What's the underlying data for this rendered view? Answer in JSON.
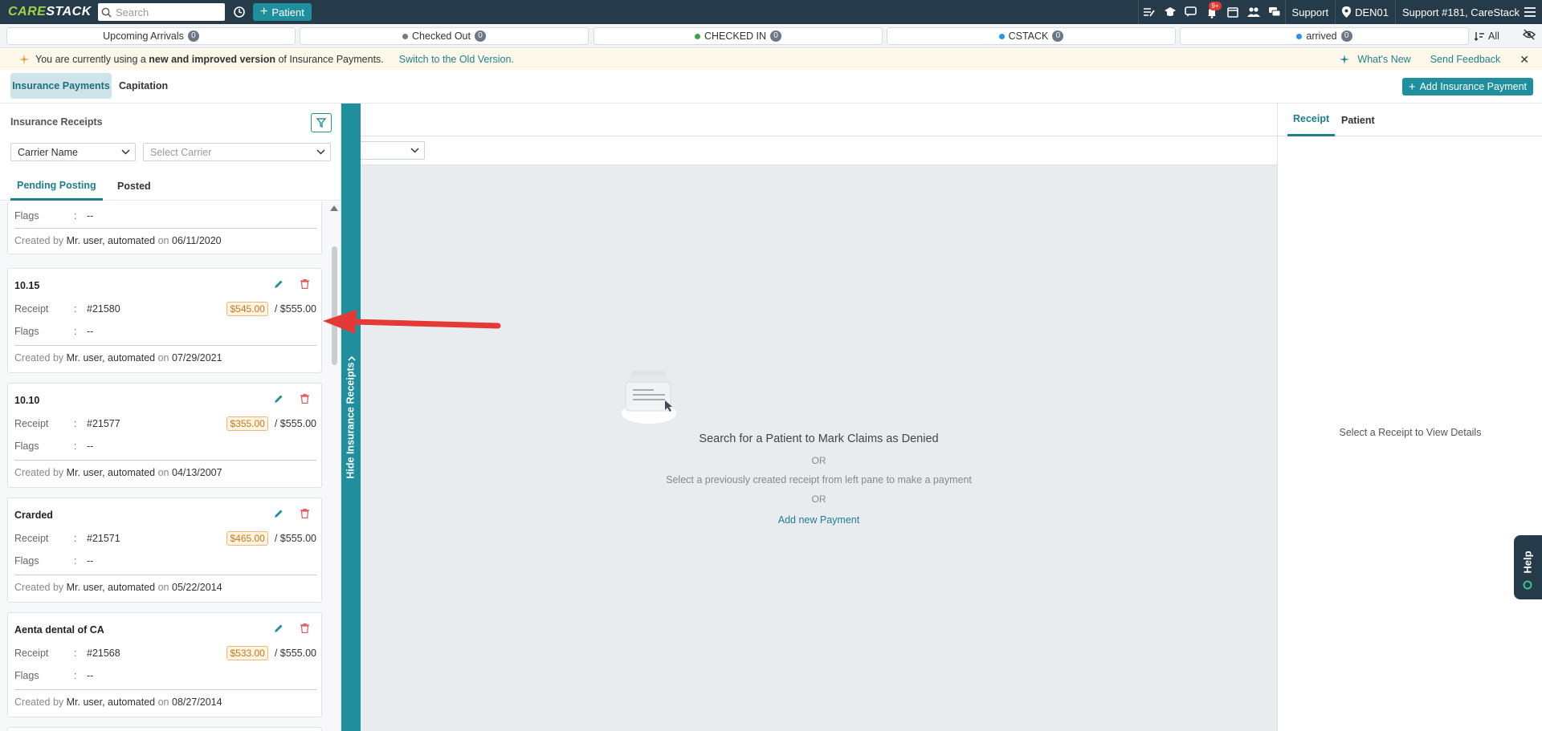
{
  "app": {
    "logo": "CARESTACK",
    "search_placeholder": "Search",
    "patient_button": "Patient",
    "badge_count": "9+",
    "support_label": "Support",
    "location": "DEN01",
    "user_label": "Support #181, CareStack"
  },
  "status_bar": {
    "items": [
      {
        "label": "Upcoming Arrivals",
        "count": "0",
        "dot_color": ""
      },
      {
        "label": "Checked Out",
        "count": "0",
        "dot_color": "#7a7a7a"
      },
      {
        "label": "CHECKED IN",
        "count": "0",
        "dot_color": "#3aa647"
      },
      {
        "label": "CSTACK",
        "count": "0",
        "dot_color": "#2196f3"
      },
      {
        "label": "arrived",
        "count": "0",
        "dot_color": "#2196f3"
      }
    ],
    "all_label": "All"
  },
  "notice": {
    "text_before": "You are currently using a ",
    "text_bold": "new and improved version",
    "text_after": " of Insurance Payments.",
    "switch_link": "Switch to the Old Version.",
    "whats_new": "What's New",
    "send_feedback": "Send Feedback"
  },
  "tabs": {
    "insurance_payments": "Insurance Payments",
    "capitation": "Capitation",
    "add_button": "Add Insurance Payment"
  },
  "left_pane": {
    "title": "Insurance Receipts",
    "carrier_select": "Carrier Name",
    "carrier_placeholder": "Select Carrier",
    "tab_pending": "Pending Posting",
    "tab_posted": "Posted",
    "partial_card": {
      "flags_label": "Flags",
      "flags_value": "--",
      "created_by": "Mr. user, automated",
      "created_on": "06/11/2020"
    },
    "cards": [
      {
        "title": "10.15",
        "receipt": "#21580",
        "paid": "$545.00",
        "total": "/ $555.00",
        "flags": "--",
        "created_by": "Mr. user, automated",
        "created_on": "07/29/2021"
      },
      {
        "title": "10.10",
        "receipt": "#21577",
        "paid": "$355.00",
        "total": "/ $555.00",
        "flags": "--",
        "created_by": "Mr. user, automated",
        "created_on": "04/13/2007"
      },
      {
        "title": "Crarded",
        "receipt": "#21571",
        "paid": "$465.00",
        "total": "/ $555.00",
        "flags": "--",
        "created_by": "Mr. user, automated",
        "created_on": "05/22/2014"
      },
      {
        "title": "Aenta dental of CA",
        "receipt": "#21568",
        "paid": "$533.00",
        "total": "/ $555.00",
        "flags": "--",
        "created_by": "Mr. user, automated",
        "created_on": "08/27/2014"
      }
    ],
    "labels": {
      "receipt": "Receipt",
      "flags": "Flags",
      "colon": ":",
      "created_by_prefix": "Created by",
      "on": "on"
    }
  },
  "hide_strip": "Hide Insurance Receipts",
  "center": {
    "title": "Search for a Patient to Mark Claims as Denied",
    "or": "OR",
    "subtitle": "Select a previously created receipt from left pane to make a payment",
    "add_link": "Add new Payment"
  },
  "right_pane": {
    "tab_receipt": "Receipt",
    "tab_patient": "Patient",
    "empty_message": "Select a Receipt to View Details"
  },
  "help": "Help"
}
